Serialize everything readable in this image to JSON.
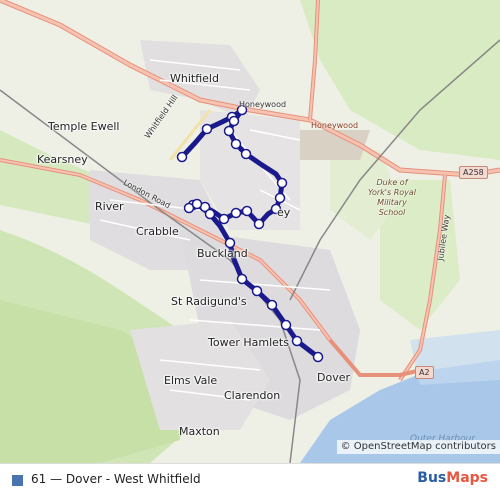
{
  "map": {
    "places": [
      {
        "key": "whitfield",
        "label": "Whitfield"
      },
      {
        "key": "temple_ewell",
        "label": "Temple Ewell"
      },
      {
        "key": "kearsney",
        "label": "Kearsney"
      },
      {
        "key": "river",
        "label": "River"
      },
      {
        "key": "crabble",
        "label": "Crabble"
      },
      {
        "key": "buckland",
        "label": "Buckland"
      },
      {
        "key": "st_radigunds",
        "label": "St Radigund's"
      },
      {
        "key": "tower_hamlets",
        "label": "Tower Hamlets"
      },
      {
        "key": "elms_vale",
        "label": "Elms Vale"
      },
      {
        "key": "clarendon",
        "label": "Clarendon"
      },
      {
        "key": "maxton",
        "label": "Maxton"
      },
      {
        "key": "dover",
        "label": "Dover"
      },
      {
        "key": "valley",
        "label": "ey"
      }
    ],
    "roads": {
      "honeywood_1": "Honeywood",
      "honeywood_2": "Honeywood",
      "whitfield_hill": "Whitfield Hill",
      "london_road": "London Road",
      "jubilee_way": "Jubilee Way",
      "a258": "A258",
      "a2": "A2"
    },
    "school": "Duke of York's Royal Military School",
    "school_lines": [
      "Duke of",
      "York's Royal",
      "Military",
      "School"
    ],
    "harbour": "Outer Harbour",
    "attribution": "© OpenStreetMap contributors",
    "colors": {
      "route": "#1a1a8c",
      "stop_fill": "#ffffff",
      "highway": "#e8907a",
      "water": "#a9c7e8",
      "greenland": "#cfe5b5"
    }
  },
  "legend": {
    "swatch_color": "#4a74b0",
    "label": "61 — Dover - West Whitfield"
  },
  "brand": {
    "part1": "Bus",
    "part2": "Maps"
  }
}
